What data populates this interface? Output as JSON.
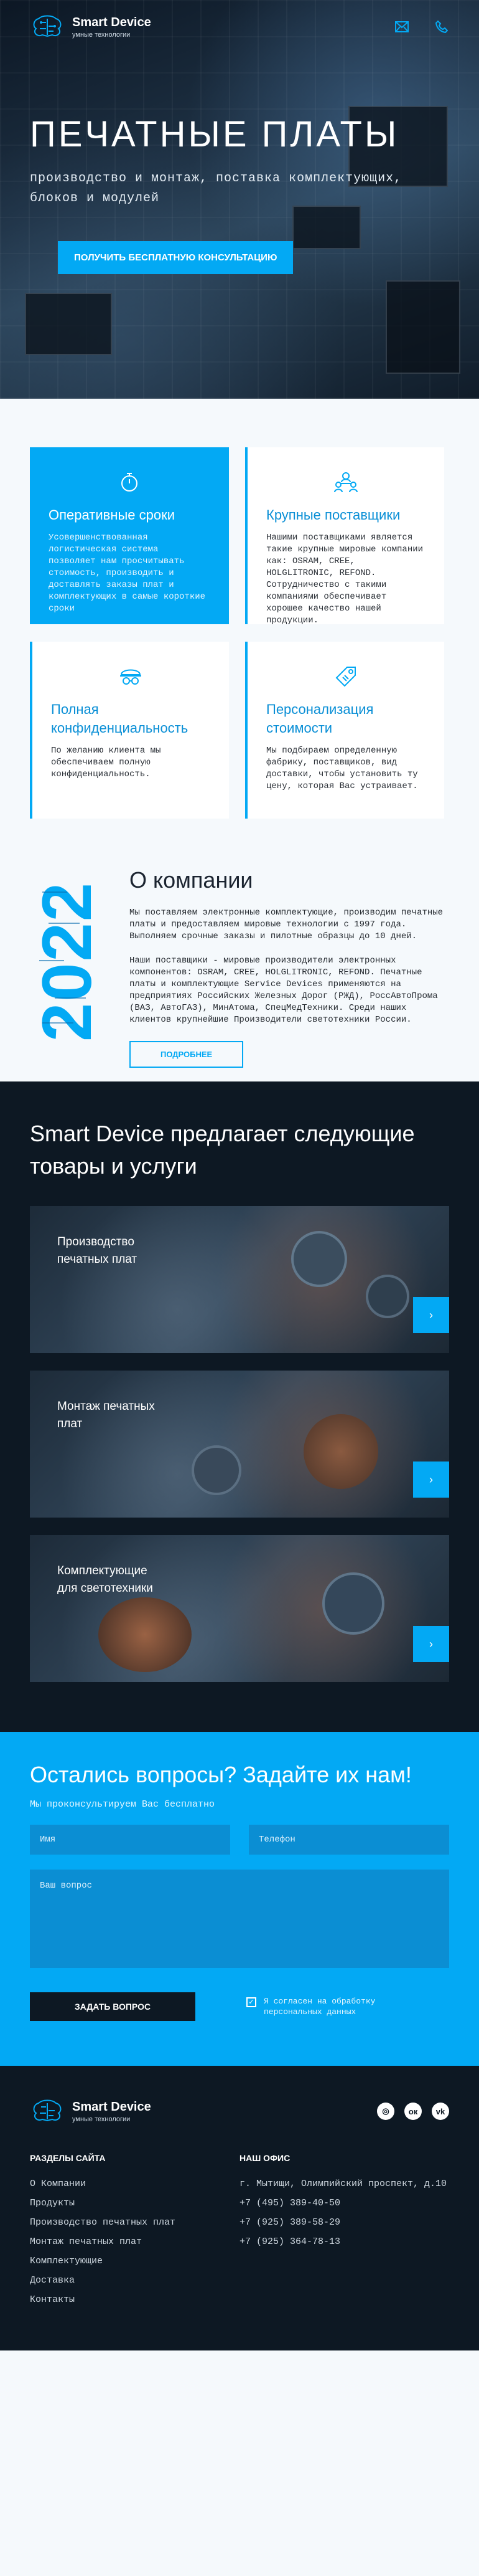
{
  "brand": {
    "name": "Smart Device",
    "tagline": "умные технологии"
  },
  "header": {
    "icons": [
      "mail-icon",
      "phone-icon"
    ]
  },
  "hero": {
    "title": "ПЕЧАТНЫЕ ПЛАТЫ",
    "subtitle": "производство и монтаж, поставка комплектующих, блоков и модулей",
    "cta": "ПОЛУЧИТЬ БЕСПЛАТНУЮ КОНСУЛЬТАЦИЮ"
  },
  "features": [
    {
      "icon": "stopwatch-icon",
      "title": "Оперативные сроки",
      "text": "Усовершенствованная логистическая система позволяет нам просчитывать стоимость, производить и доставлять заказы плат и комплектующих в самые короткие сроки"
    },
    {
      "icon": "suppliers-icon",
      "title": "Крупные поставщики",
      "text": "Нашими поставщиками является такие крупные мировые компании как: OSRAM, CREE, HOLGLITRONIC, REFOND. Сотрудничество с такими компаниями обеспечивает хорошее качество нашей продукции."
    },
    {
      "icon": "privacy-icon",
      "title": "Полная конфиденциальность",
      "text": "По желанию клиента мы обеспечиваем полную конфиденциальность."
    },
    {
      "icon": "price-tag-icon",
      "title": "Персонализация стоимости",
      "text": "Мы подбираем определенную фабрику, поставщиков, вид доставки, чтобы установить ту цену, которая Вас устраивает."
    }
  ],
  "about": {
    "year": "2022",
    "title": "О компании",
    "p1": "Мы поставляем электронные комплектующие, производим печатные платы и предоставляем мировые технологии с 1997 года. Выполняем срочные заказы и пилотные образцы до 10 дней.",
    "p2": "Наши поставщики - мировые производители электронных компонентов: OSRAM, CREE, HOLGLITRONIC, REFOND. Печатные платы и комплектующие Service Devices применяются на предприятиях Российских Железных Дорог (РЖД), РоссАвтоПрома (ВАЗ, АвтоГАЗ), МинАтома, СпецМедТехники. Среди наших клиентов крупнейшие Производители светотехники России.",
    "button": "ПОДРОБНЕЕ"
  },
  "services": {
    "title": "Smart Device предлагает следующие товары и услуги",
    "items": [
      {
        "label": "Производство печатных плат"
      },
      {
        "label": "Монтаж печатных плат"
      },
      {
        "label": "Комплектующие для светотехники"
      }
    ],
    "arrow": "›"
  },
  "contact": {
    "title": "Остались вопросы? Задайте их нам!",
    "subtitle": "Мы проконсультируем Вас бесплатно",
    "name_placeholder": "Имя",
    "phone_placeholder": "Телефон",
    "question_placeholder": "Ваш вопрос",
    "submit": "ЗАДАТЬ ВОПРОС",
    "agree": "Я согласен на обработку персональных данных"
  },
  "footer": {
    "sections_title": "РАЗДЕЛЫ САЙТА",
    "sections": [
      "О Компании",
      "Продукты",
      "Производство печатных плат",
      "Монтаж печатных плат",
      "Комплектующие",
      "Доставка",
      "Контакты"
    ],
    "office_title": "НАШ ОФИС",
    "office": [
      "г. Мытищи, Олимпийский проспект, д.10",
      "+7 (495) 389-40-50",
      "+7 (925) 389-58-29",
      "+7 (925) 364-78-13"
    ],
    "socials": [
      {
        "icon": "instagram-icon",
        "glyph": "◎"
      },
      {
        "icon": "odnoklassniki-icon",
        "glyph": "ок"
      },
      {
        "icon": "vk-icon",
        "glyph": "vk"
      }
    ]
  },
  "colors": {
    "accent": "#03a9f4",
    "dark": "#0d1823"
  }
}
